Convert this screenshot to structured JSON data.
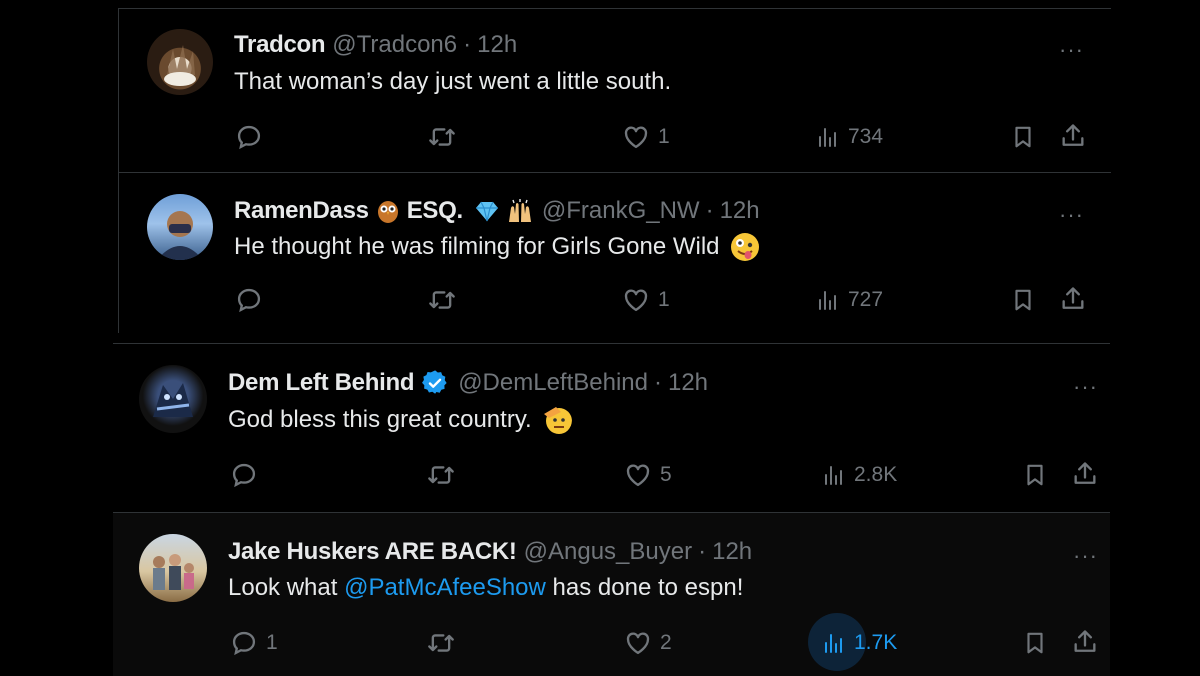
{
  "tweets": [
    {
      "name": "Tradcon",
      "handle": "@Tradcon6",
      "time": "12h",
      "text": "That woman’s day just went a little south.",
      "more": "···",
      "replies": "",
      "likes": "1",
      "views": "734"
    },
    {
      "name": "RamenDass",
      "name_suffix": "ESQ.",
      "handle": "@FrankG_NW",
      "time": "12h",
      "text": "He thought he was filming for Girls Gone Wild",
      "more": "···",
      "replies": "",
      "likes": "1",
      "views": "727"
    },
    {
      "name": "Dem Left Behind",
      "handle": "@DemLeftBehind",
      "time": "12h",
      "text": "God bless this great country.",
      "more": "···",
      "replies": "",
      "likes": "5",
      "views": "2.8K"
    },
    {
      "name": "Jake Huskers ARE BACK!",
      "handle": "@Angus_Buyer",
      "time": "12h",
      "text_before": "Look what ",
      "mention": "@PatMcAfeeShow",
      "text_after": " has done to espn!",
      "more": "···",
      "replies": "1",
      "likes": "2",
      "views": "1.7K"
    }
  ],
  "separator": "·",
  "colors": {
    "background": "#000000",
    "text": "#e7e9ea",
    "muted": "#71767b",
    "accent": "#1d9bf0",
    "border": "#2f3336",
    "verified": "#1d9bf0"
  },
  "icons": [
    "reply-icon",
    "retweet-icon",
    "like-icon",
    "views-icon",
    "bookmark-icon",
    "share-icon",
    "more-icon",
    "verified-badge-icon"
  ]
}
